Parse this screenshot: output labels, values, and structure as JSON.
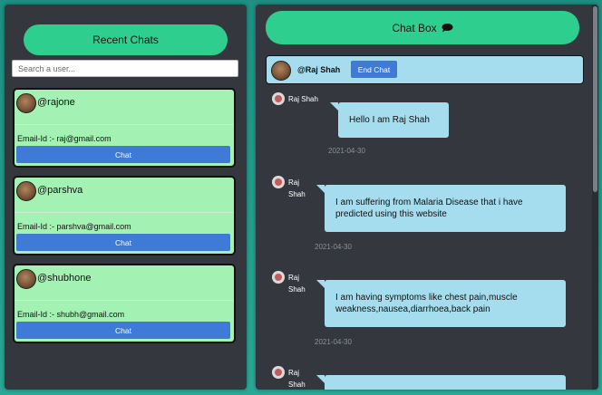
{
  "left_panel": {
    "title": "Recent Chats",
    "search_placeholder": "Search a user...",
    "users": [
      {
        "username": "@rajone",
        "email": "Email-Id :- raj@gmail.com",
        "button": "Chat"
      },
      {
        "username": "@parshva",
        "email": "Email-Id :- parshva@gmail.com",
        "button": "Chat"
      },
      {
        "username": "@shubhone",
        "email": "Email-Id :- shubh@gmail.com",
        "button": "Chat"
      }
    ]
  },
  "right_panel": {
    "title": "Chat Box",
    "title_icon": "speech-bubble-icon",
    "active_user": "@Raj Shah",
    "end_chat_label": "End Chat",
    "messages": [
      {
        "sender": "Raj Shah",
        "text": "Hello I am Raj Shah",
        "date": "2021-04-30"
      },
      {
        "sender": "Raj Shah",
        "text": "I am suffering from Malaria Disease that i have predicted using this website",
        "date": "2021-04-30"
      },
      {
        "sender": "Raj Shah",
        "text": "I am having symptoms like chest pain,muscle weakness,nausea,diarrhoea,back pain",
        "date": "2021-04-30"
      },
      {
        "sender": "Raj Shah",
        "text": "",
        "date": ""
      }
    ]
  },
  "colors": {
    "accent_green": "#2ecf8e",
    "card_green": "#a3f2b3",
    "button_blue": "#3e7ad6",
    "bubble_blue": "#a5ddef",
    "panel_dark": "#34383e"
  }
}
